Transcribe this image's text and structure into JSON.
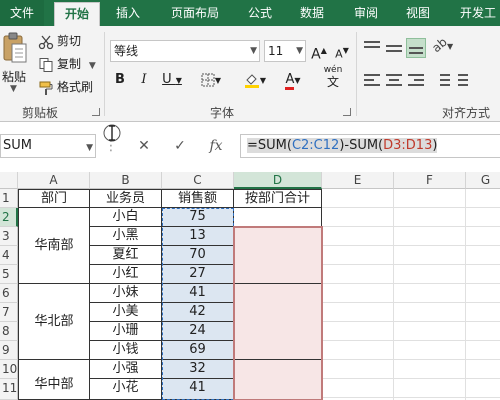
{
  "tabs": {
    "file": "文件",
    "home": "开始",
    "insert": "插入",
    "layout": "页面布局",
    "formula": "公式",
    "data": "数据",
    "review": "审阅",
    "view": "视图",
    "developer": "开发工"
  },
  "ribbon": {
    "clipboard": {
      "paste": "粘贴",
      "cut": "剪切",
      "copy": "复制",
      "format_painter": "格式刷",
      "label": "剪贴板"
    },
    "font": {
      "name": "等线",
      "size": "11",
      "label": "字体",
      "wen": "wén",
      "wen_char": "文"
    },
    "alignment": {
      "label": "对齐方式"
    }
  },
  "formula_bar": {
    "name_box": "SUM",
    "fx": "fx",
    "formula_prefix": "=SUM(",
    "ref1": "C2:C12",
    "formula_mid": ")-SUM(",
    "ref2": "D3:D13",
    "formula_suffix": ")"
  },
  "grid": {
    "col_headers": [
      "A",
      "B",
      "C",
      "D",
      "E",
      "F",
      "G"
    ],
    "row_headers": [
      "1",
      "2",
      "3",
      "4",
      "5",
      "6",
      "7",
      "8",
      "9",
      "10",
      "11"
    ],
    "headers": {
      "dept": "部门",
      "salesperson": "业务员",
      "sales": "销售额",
      "dept_total": "按部门合计"
    },
    "depts": [
      "华南部",
      "华北部",
      "华中部"
    ],
    "rows": [
      {
        "name": "小白",
        "sales": "75"
      },
      {
        "name": "小黑",
        "sales": "13"
      },
      {
        "name": "夏红",
        "sales": "70"
      },
      {
        "name": "小红",
        "sales": "27"
      },
      {
        "name": "小妹",
        "sales": "41"
      },
      {
        "name": "小美",
        "sales": "42"
      },
      {
        "name": "小珊",
        "sales": "24"
      },
      {
        "name": "小钱",
        "sales": "69"
      },
      {
        "name": "小强",
        "sales": "32"
      },
      {
        "name": "小花",
        "sales": "41"
      }
    ]
  },
  "colors": {
    "accent": "#217346",
    "ref_blue": "#2e6fc0",
    "ref_red": "#c0392b"
  }
}
